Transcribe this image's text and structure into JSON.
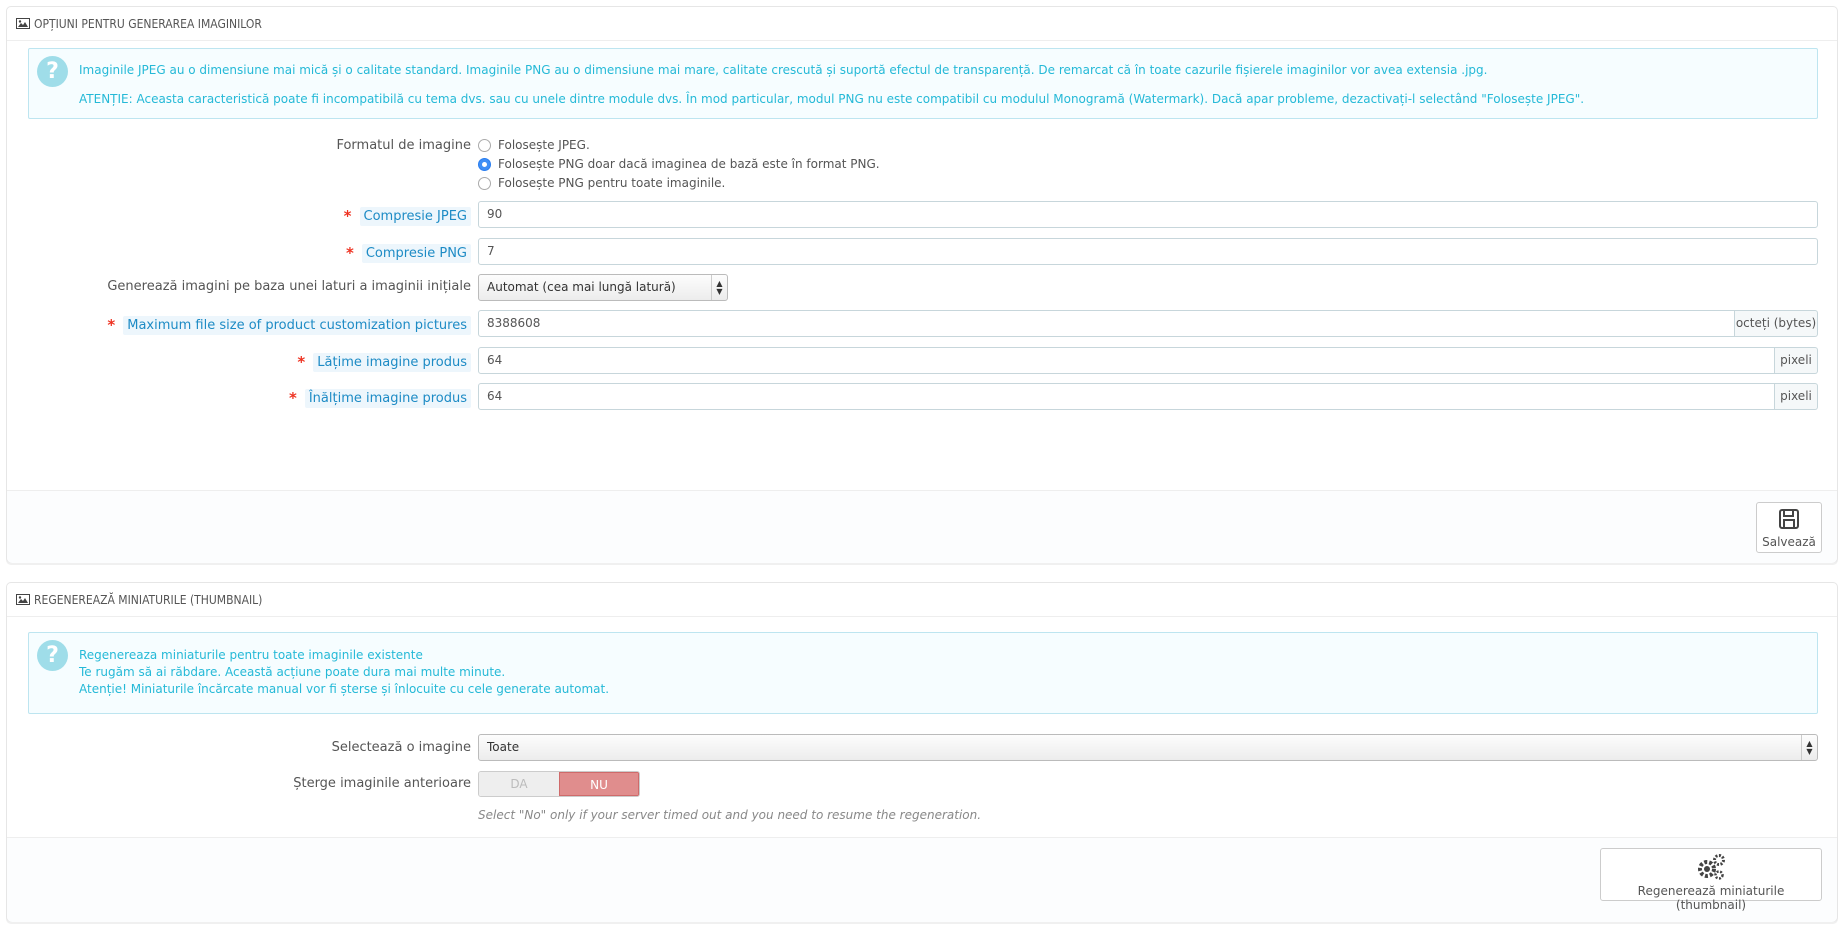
{
  "panel1": {
    "title": "OPȚIUNI PENTRU GENERAREA IMAGINILOR",
    "info": {
      "line1": "Imaginile JPEG au o dimensiune mai mică și o calitate standard. Imaginile PNG au o dimensiune mai mare, calitate crescută și suportă efectul de transparență. De remarcat că în toate cazurile fișierele imaginilor vor avea extensia .jpg.",
      "line2": "ATENȚIE: Aceasta caracteristică poate fi incompatibilă cu tema dvs. sau cu unele dintre module dvs. În mod particular, modul PNG nu este compatibil cu modulul Monogramă (Watermark). Dacă apar probleme, dezactivați-l selectând \"Folosește JPEG\"."
    },
    "format": {
      "label": "Formatul de imagine",
      "options": [
        {
          "label": "Folosește JPEG.",
          "checked": false
        },
        {
          "label": "Folosește PNG doar dacă imaginea de bază este în format PNG.",
          "checked": true
        },
        {
          "label": "Folosește PNG pentru toate imaginile.",
          "checked": false
        }
      ]
    },
    "jpeg": {
      "label": "Compresie JPEG",
      "value": "90"
    },
    "png": {
      "label": "Compresie PNG",
      "value": "7"
    },
    "side": {
      "label": "Generează imagini pe baza unei laturi a imaginii inițiale",
      "value": "Automat (cea mai lungă latură)"
    },
    "maxsize": {
      "label": "Maximum file size of product customization pictures",
      "value": "8388608",
      "unit": "octeți (bytes)"
    },
    "width": {
      "label": "Lățime imagine produs",
      "value": "64",
      "unit": "pixeli"
    },
    "height": {
      "label": "Înălțime imagine produs",
      "value": "64",
      "unit": "pixeli"
    },
    "save_label": "Salvează"
  },
  "panel2": {
    "title": "REGENEREAZĂ MINIATURILE (THUMBNAIL)",
    "info": {
      "line1": "Regenereaza miniaturile pentru toate imaginile existente",
      "line2": "Te rugăm să ai răbdare. Această acțiune poate dura mai multe minute.",
      "line3": "Atenție! Miniaturile încărcate manual vor fi șterse și înlocuite cu cele generate automat."
    },
    "select": {
      "label": "Selectează o imagine",
      "value": "Toate"
    },
    "erase": {
      "label": "Șterge imaginile anterioare",
      "yes": "DA",
      "no": "NU",
      "selected": "NU"
    },
    "help": "Select \"No\" only if your server timed out and you need to resume the regeneration.",
    "regen_label": "Regenerează miniaturile (thumbnail)"
  },
  "colors": {
    "accent": "#25b9d7",
    "required": "#e32222",
    "no_toggle": "#e08d8d"
  }
}
